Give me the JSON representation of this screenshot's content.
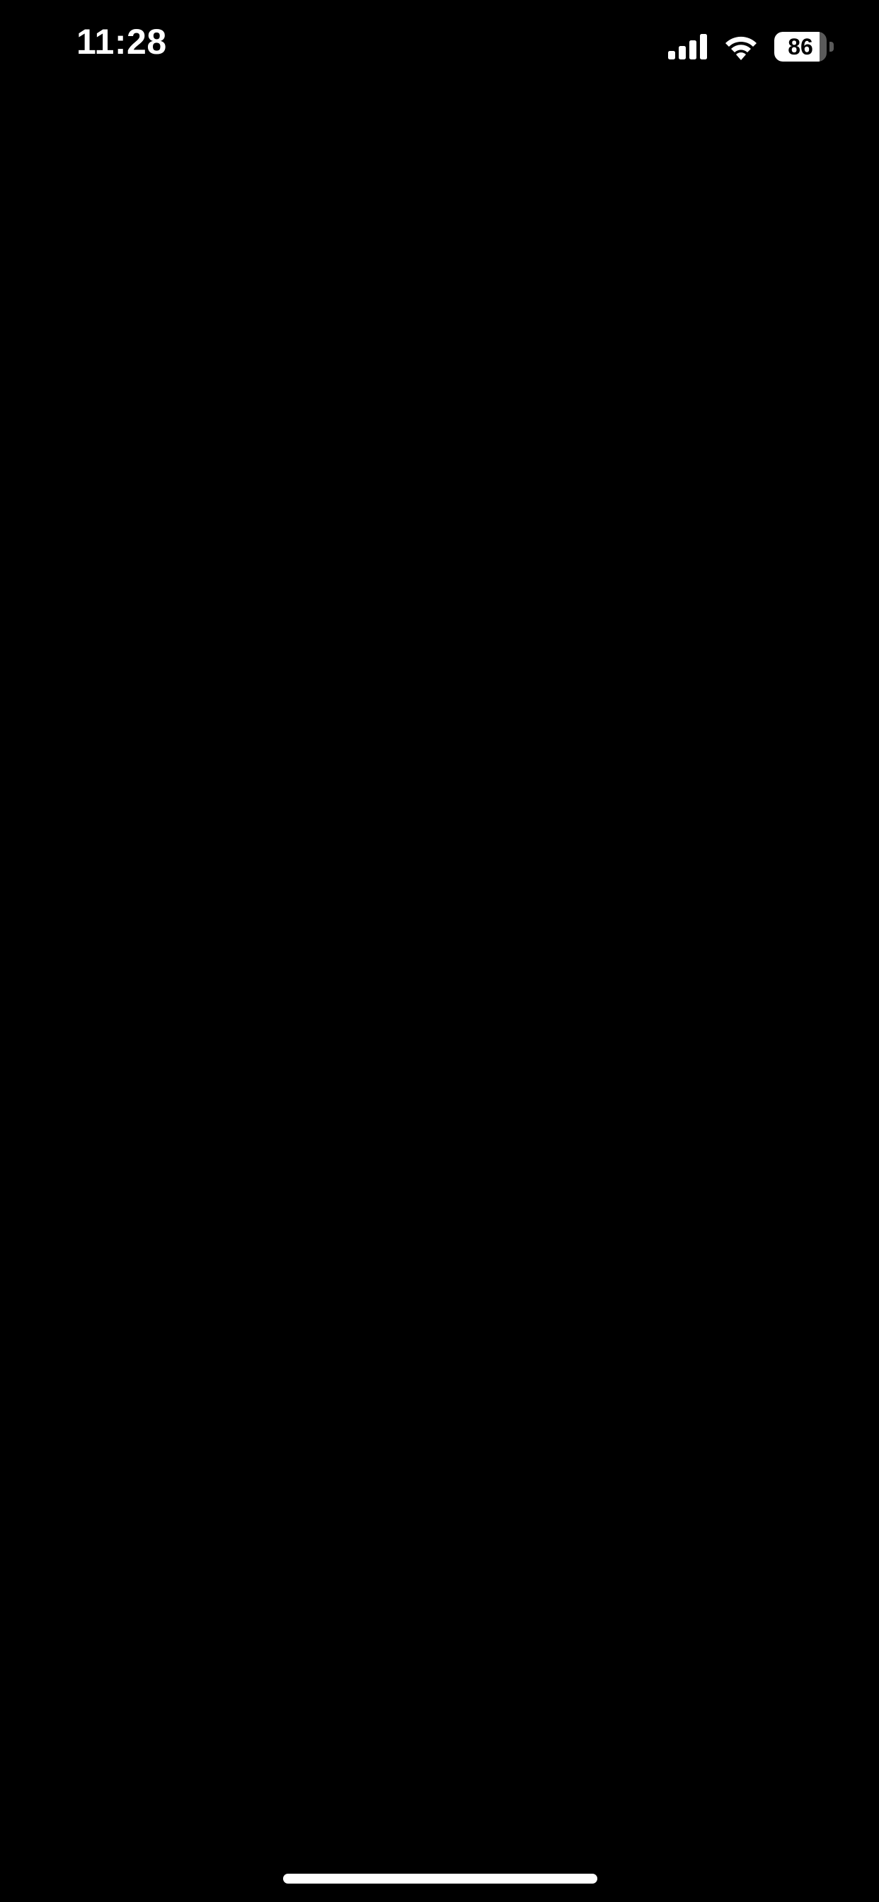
{
  "status_bar": {
    "time": "11:28",
    "battery_level": "86",
    "battery_fraction": 0.86,
    "icons": [
      "cellular-signal-icon",
      "wifi-icon",
      "battery-icon"
    ]
  },
  "colors": {
    "background": "#000000",
    "foreground": "#ffffff"
  }
}
